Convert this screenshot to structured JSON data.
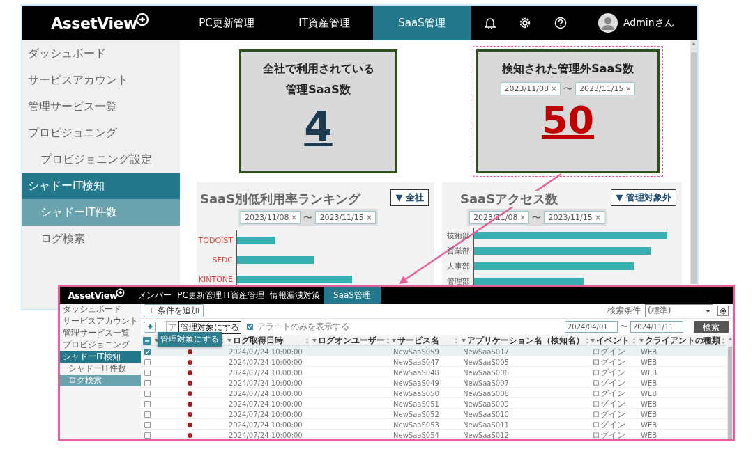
{
  "app": {
    "logo": "AssetView",
    "nav": [
      {
        "label": "PC更新管理",
        "selected": false
      },
      {
        "label": "IT資産管理",
        "selected": false
      },
      {
        "label": "SaaS管理",
        "selected": true
      }
    ],
    "user": "Adminさん"
  },
  "sidebar": [
    {
      "label": "ダッシュボード",
      "selected": false
    },
    {
      "label": "サービスアカウント",
      "selected": false
    },
    {
      "label": "管理サービス一覧",
      "selected": false
    },
    {
      "label": "プロビジョニング",
      "selected": false,
      "children": [
        {
          "label": "プロビジョニング設定",
          "selected": false
        }
      ]
    },
    {
      "label": "シャドーIT検知",
      "selected": true,
      "children": [
        {
          "label": "シャドーIT件数",
          "selected": true
        },
        {
          "label": "ログ検索",
          "selected": false
        }
      ]
    }
  ],
  "cards": [
    {
      "kind": "managed",
      "title_lines": [
        "全社で利用されている",
        "管理SaaS数"
      ],
      "value": "4",
      "highlighted": false
    },
    {
      "kind": "unmanaged",
      "title": "検知された管理外SaaS数",
      "date_from": "2023/11/08",
      "range_sep": "〜",
      "date_to": "2023/11/15",
      "value": "50",
      "highlighted": true
    }
  ],
  "charts": [
    {
      "kind": "ranking",
      "title": "SaaS別低利用率ランキング",
      "filter": "▼ 全社",
      "date_from": "2023/11/08",
      "range_sep": "〜",
      "date_to": "2023/11/15",
      "labels": [
        "TODOIST",
        "SFDC",
        "KINTONE"
      ]
    },
    {
      "kind": "access",
      "title": "SaaSアクセス数",
      "filter": "▼ 管理対象外",
      "date_from": "2023/11/08",
      "range_sep": "〜",
      "date_to": "2023/11/15",
      "labels": [
        "技術部",
        "営業部",
        "人事部",
        "管理部"
      ]
    }
  ],
  "inset": {
    "logo": "AssetView",
    "nav": [
      {
        "label": "メンバー",
        "selected": false
      },
      {
        "label": "PC更新管理",
        "selected": false
      },
      {
        "label": "IT資産管理",
        "selected": false
      },
      {
        "label": "情報漏洩対策",
        "selected": false
      },
      {
        "label": "SaaS管理",
        "selected": true
      }
    ],
    "sidebar": [
      {
        "label": "ダッシュボード",
        "selected": false
      },
      {
        "label": "サービスアカウント",
        "selected": false
      },
      {
        "label": "管理サービス一覧",
        "selected": false
      },
      {
        "label": "プロビジョニング",
        "selected": false
      },
      {
        "label": "シャドーIT検知",
        "selected": true,
        "children": [
          {
            "label": "シャドーIT件数",
            "selected": false
          },
          {
            "label": "ログ検索",
            "selected": true
          }
        ]
      }
    ],
    "toolbar": {
      "add_condition": "+ 条件を追加",
      "search_condition_label": "検索条件",
      "search_condition_value": "(標準)",
      "action_select": "ア",
      "tooltip": "管理対象にする",
      "alerts_only": {
        "label": "アラートのみを表示する",
        "checked": true
      },
      "date_from": "2024/04/01",
      "range_sep": "〜",
      "date_to": "2024/11/11",
      "search_button": "検索"
    },
    "menu": [
      "管理対象にする"
    ],
    "table": {
      "select_all": {
        "indeterminate": true
      },
      "columns": [
        {
          "kind": "alert"
        },
        {
          "label": "ログ取得日時"
        },
        {
          "label": "ログオンユーザー"
        },
        {
          "label": "サービス名"
        },
        {
          "label": "アプリケーション名（検知名）"
        },
        {
          "label": "イベント"
        },
        {
          "label": "クライアントの種類"
        }
      ],
      "rows": [
        {
          "selected": true,
          "alert": true,
          "logged_at": "2024/07/24 10:00:00",
          "service": "NewSaaS059",
          "application": "NewSaaS017",
          "event": "ログイン",
          "client": "WEB"
        },
        {
          "selected": false,
          "alert": true,
          "logged_at": "2024/07/24 10:00:00",
          "service": "NewSaaS047",
          "application": "NewSaaS005",
          "event": "ログイン",
          "client": "WEB"
        },
        {
          "selected": false,
          "alert": true,
          "logged_at": "2024/07/24 10:00:00",
          "service": "NewSaaS048",
          "application": "NewSaaS006",
          "event": "ログイン",
          "client": "WEB"
        },
        {
          "selected": false,
          "alert": true,
          "logged_at": "2024/07/24 10:00:00",
          "service": "NewSaaS049",
          "application": "NewSaaS007",
          "event": "ログイン",
          "client": "WEB"
        },
        {
          "selected": false,
          "alert": true,
          "logged_at": "2024/07/24 10:00:00",
          "service": "NewSaaS050",
          "application": "NewSaaS008",
          "event": "ログイン",
          "client": "WEB"
        },
        {
          "selected": false,
          "alert": true,
          "logged_at": "2024/07/24 10:00:00",
          "service": "NewSaaS051",
          "application": "NewSaaS009",
          "event": "ログイン",
          "client": "WEB"
        },
        {
          "selected": false,
          "alert": true,
          "logged_at": "2024/07/24 10:00:00",
          "service": "NewSaaS052",
          "application": "NewSaaS010",
          "event": "ログイン",
          "client": "WEB"
        },
        {
          "selected": false,
          "alert": true,
          "logged_at": "2024/07/24 10:00:00",
          "service": "NewSaaS053",
          "application": "NewSaaS011",
          "event": "ログイン",
          "client": "WEB"
        },
        {
          "selected": false,
          "alert": true,
          "logged_at": "2024/07/24 10:00:00",
          "service": "NewSaaS054",
          "application": "NewSaaS012",
          "event": "ログイン",
          "client": "WEB"
        }
      ]
    }
  }
}
